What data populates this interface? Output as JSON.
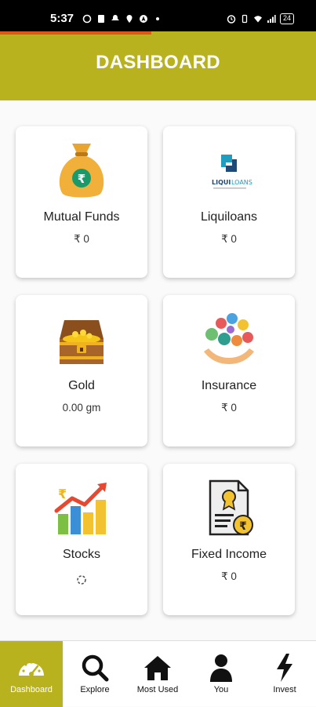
{
  "status_bar": {
    "time": "5:37",
    "battery": "24"
  },
  "header": {
    "title": "DASHBOARD"
  },
  "cards": [
    {
      "label": "Mutual Funds",
      "value": "₹ 0",
      "icon": "money-bag-icon"
    },
    {
      "label": "Liquiloans",
      "value": "₹ 0",
      "icon": "liquiloans-logo"
    },
    {
      "label": "Gold",
      "value": "0.00 gm",
      "icon": "treasure-chest-icon"
    },
    {
      "label": "Insurance",
      "value": "₹ 0",
      "icon": "insurance-hands-icon"
    },
    {
      "label": "Stocks",
      "value": "",
      "icon": "stocks-chart-icon"
    },
    {
      "label": "Fixed Income",
      "value": "₹ 0",
      "icon": "certificate-icon"
    }
  ],
  "liquiloans_logo": {
    "text_a": "LIQUI",
    "text_b": "LOANS"
  },
  "bottom_nav": [
    {
      "label": "Dashboard",
      "icon": "speedometer-icon"
    },
    {
      "label": "Explore",
      "icon": "search-icon"
    },
    {
      "label": "Most Used",
      "icon": "home-icon"
    },
    {
      "label": "You",
      "icon": "user-icon"
    },
    {
      "label": "Invest",
      "icon": "lightning-icon"
    }
  ],
  "colors": {
    "accent": "#b9b21f",
    "progress": "#e2561b"
  },
  "progress": 0.48
}
